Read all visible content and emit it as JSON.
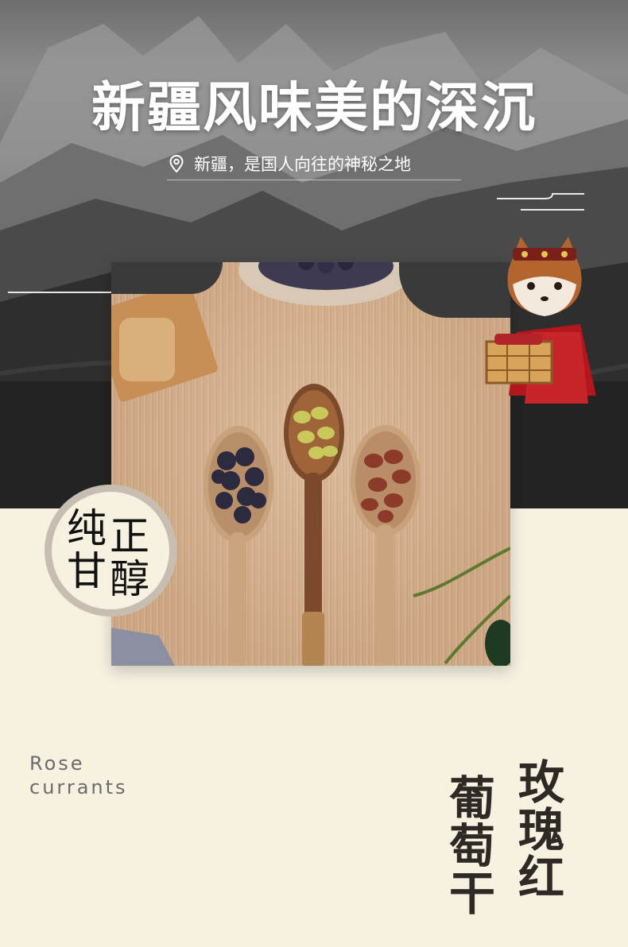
{
  "hero": {
    "title": "新疆风味美的深沉",
    "subtitle": "新疆，是国人向往的神秘之地",
    "pin_icon": "location-pin-icon"
  },
  "seal": {
    "top_left": "纯",
    "top_right": "正",
    "bottom_left": "甘",
    "bottom_right": "醇"
  },
  "product": {
    "english_line1": "Rose",
    "english_line2": "currants",
    "cn_col1": [
      "玫",
      "瑰",
      "红"
    ],
    "cn_col2": [
      "葡",
      "萄",
      "干"
    ]
  },
  "colors": {
    "cream": "#f6f1e1",
    "dark": "#202020",
    "title": "#ffffff"
  }
}
